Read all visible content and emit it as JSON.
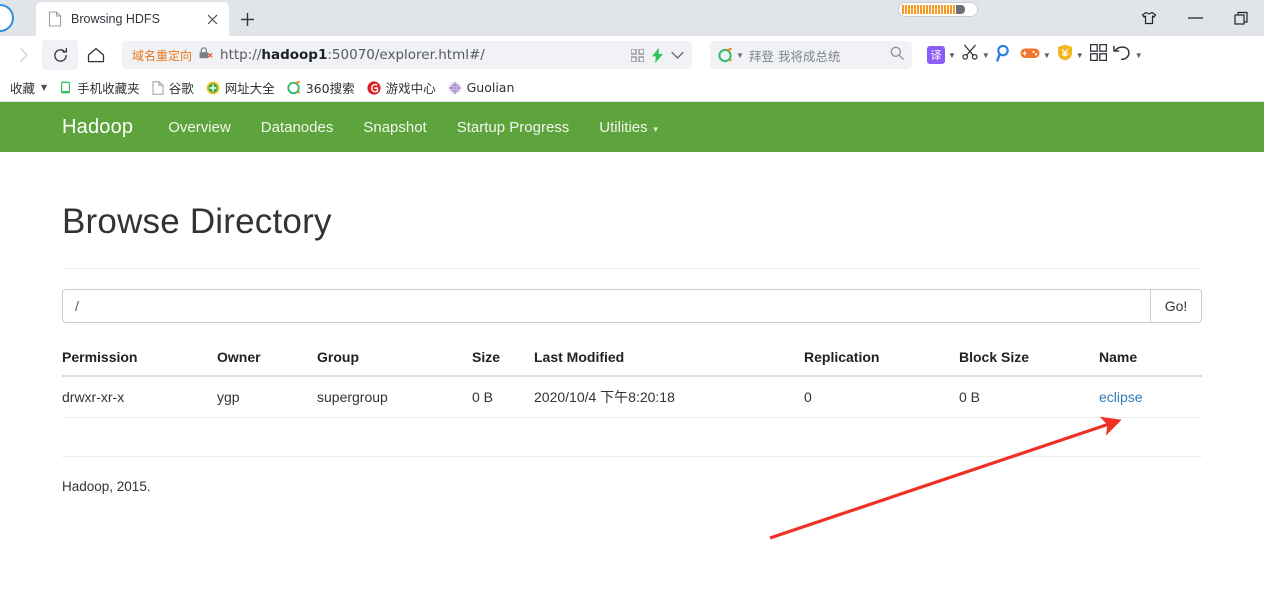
{
  "browser": {
    "tab": {
      "title": "Browsing HDFS",
      "favicon_icon": "page-icon",
      "close_icon": "close-icon"
    },
    "newtab_icon": "plus-icon",
    "window_controls": [
      {
        "name": "skin-button",
        "icon": "tshirt-icon"
      },
      {
        "name": "minimize-button",
        "icon": "minimize-icon"
      },
      {
        "name": "restore-button",
        "icon": "restore-icon"
      }
    ],
    "nav": {
      "forward_icon": "forward-arrow-icon",
      "reload_icon": "reload-icon",
      "home_icon": "home-icon"
    },
    "omnibox": {
      "redirect_badge": "域名重定向",
      "security_icon": "lock-with-x-icon",
      "url_prefix": "http://",
      "url_host": "hadoop1",
      "url_rest": ":50070/explorer.html#/",
      "qr_icon": "qr-code-icon",
      "lightning_icon": "lightning-icon",
      "chevron_icon": "chevron-down-icon"
    },
    "search": {
      "engine_icon": "360-search-icon",
      "caret_icon": "chevron-down-icon",
      "value": "拜登 我将成总统",
      "search_icon": "search-icon"
    },
    "tools": [
      {
        "name": "translate-tool",
        "icon": "translate-icon",
        "glyph": "译",
        "color": "#8b5cf6",
        "caret": true
      },
      {
        "name": "screenshot-tool",
        "icon": "scissors-icon",
        "caret": true
      },
      {
        "name": "find-tool",
        "icon": "magnifier-icon",
        "caret": false
      },
      {
        "name": "game-tool",
        "icon": "game-controller-icon",
        "caret": true
      },
      {
        "name": "shield-tool",
        "icon": "shield-yen-icon",
        "caret": true
      },
      {
        "name": "apps-tool",
        "icon": "grid-apps-icon",
        "caret": false
      },
      {
        "name": "undo-tool",
        "icon": "undo-arrow-icon",
        "caret": true
      }
    ],
    "bookmarks": [
      {
        "label": "收藏",
        "icon": "star-folder-icon",
        "caret": true
      },
      {
        "label": "手机收藏夹",
        "icon": "phone-icon"
      },
      {
        "label": "谷歌",
        "icon": "page-icon"
      },
      {
        "label": "网址大全",
        "icon": "hao-plus-icon"
      },
      {
        "label": "360搜索",
        "icon": "360-search-icon"
      },
      {
        "label": "游戏中心",
        "icon": "game-center-icon"
      },
      {
        "label": "Guolian",
        "icon": "guolian-icon"
      }
    ]
  },
  "hadoop": {
    "brand": "Hadoop",
    "nav_items": [
      {
        "label": "Overview",
        "has_caret": false
      },
      {
        "label": "Datanodes",
        "has_caret": false
      },
      {
        "label": "Snapshot",
        "has_caret": false
      },
      {
        "label": "Startup Progress",
        "has_caret": false
      },
      {
        "label": "Utilities",
        "has_caret": true
      }
    ],
    "page_title": "Browse Directory",
    "path_value": "/",
    "path_placeholder": "/",
    "go_label": "Go!",
    "table": {
      "headers": [
        "Permission",
        "Owner",
        "Group",
        "Size",
        "Last Modified",
        "Replication",
        "Block Size",
        "Name"
      ],
      "rows": [
        {
          "permission": "drwxr-xr-x",
          "owner": "ygp",
          "group": "supergroup",
          "size": "0 B",
          "last_modified": "2020/10/4 下午8:20:18",
          "replication": "0",
          "block_size": "0 B",
          "name": "eclipse"
        }
      ]
    },
    "footer": "Hadoop, 2015."
  },
  "annotation": {
    "arrow_color": "#ee3124",
    "arrow_from": "770,538",
    "arrow_to": "1122,419",
    "points_at": "eclipse"
  },
  "colors": {
    "navbar_green": "#5da43c",
    "link_blue": "#337ab7",
    "redirect_orange": "#e8761b",
    "chrome_grey": "#e1e5ea"
  }
}
